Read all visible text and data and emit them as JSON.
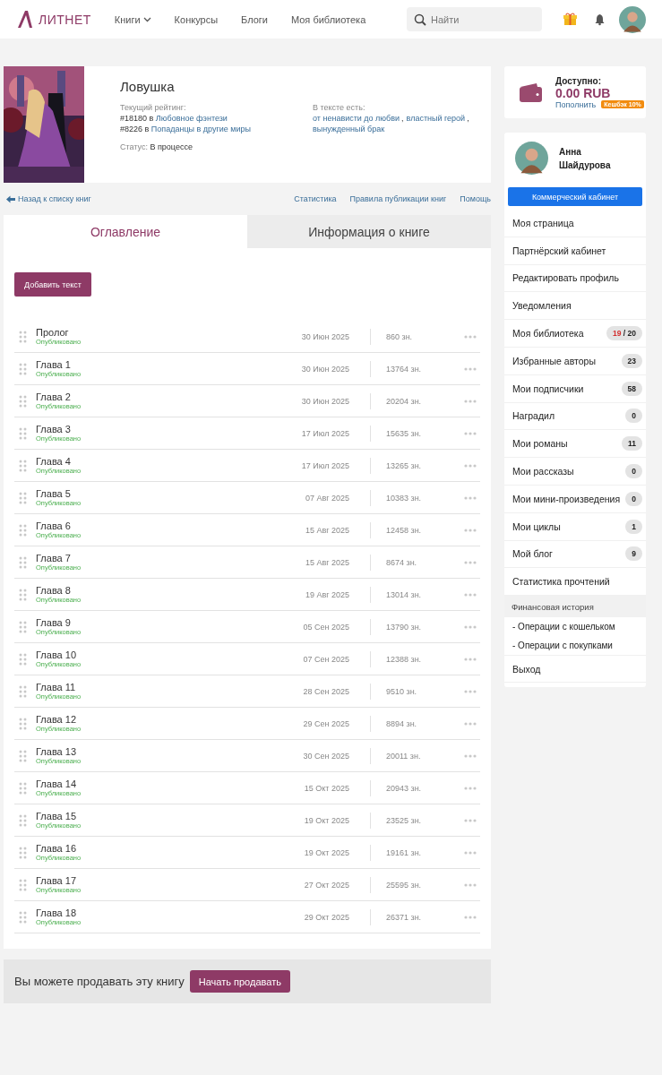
{
  "header": {
    "logo": "ЛИТНЕТ",
    "nav": [
      {
        "label": "Книги",
        "dropdown": true
      },
      {
        "label": "Конкурсы",
        "dropdown": false
      },
      {
        "label": "Блоги",
        "dropdown": false
      },
      {
        "label": "Моя библиотека",
        "dropdown": false
      }
    ],
    "search": {
      "placeholder": "Найти"
    }
  },
  "book": {
    "cover": {
      "kind": "picture"
    },
    "title": "Ловушка",
    "rating_label": "Текущий рейтинг:",
    "ratings": [
      {
        "rank": "#18180 в",
        "genre": "Любовное фэнтези"
      },
      {
        "rank": "#8226 в",
        "genre": "Попаданцы в другие миры"
      }
    ],
    "status_label": "Статус:",
    "status": "В процессе",
    "tags_label": "В тексте есть:",
    "tag_separator": ",",
    "tags": [
      "от ненависти до любви",
      "властный герой",
      "вынужденный брак"
    ]
  },
  "links": {
    "back": "Назад к списку книг",
    "right": [
      "Статистика",
      "Правила публикации книг",
      "Помощь"
    ]
  },
  "tabs": [
    {
      "label": "Оглавление",
      "selected": true
    },
    {
      "label": "Информация о книге",
      "selected": false
    }
  ],
  "add_button": "Добавить текст",
  "chapters": [
    {
      "title": "Пролог",
      "status": "Опубликовано",
      "date": "30 Июн 2025",
      "length": "860 зн."
    },
    {
      "title": "Глава 1",
      "status": "Опубликовано",
      "date": "30 Июн 2025",
      "length": "13764 зн."
    },
    {
      "title": "Глава 2",
      "status": "Опубликовано",
      "date": "30 Июн 2025",
      "length": "20204 зн."
    },
    {
      "title": "Глава 3",
      "status": "Опубликовано",
      "date": "17 Июл 2025",
      "length": "15635 зн."
    },
    {
      "title": "Глава 4",
      "status": "Опубликовано",
      "date": "17 Июл 2025",
      "length": "13265 зн."
    },
    {
      "title": "Глава 5",
      "status": "Опубликовано",
      "date": "07 Авг 2025",
      "length": "10383 зн."
    },
    {
      "title": "Глава 6",
      "status": "Опубликовано",
      "date": "15 Авг 2025",
      "length": "12458 зн."
    },
    {
      "title": "Глава 7",
      "status": "Опубликовано",
      "date": "15 Авг 2025",
      "length": "8674 зн."
    },
    {
      "title": "Глава 8",
      "status": "Опубликовано",
      "date": "19 Авг 2025",
      "length": "13014 зн."
    },
    {
      "title": "Глава 9",
      "status": "Опубликовано",
      "date": "05 Сен 2025",
      "length": "13790 зн."
    },
    {
      "title": "Глава 10",
      "status": "Опубликовано",
      "date": "07 Сен 2025",
      "length": "12388 зн."
    },
    {
      "title": "Глава 11",
      "status": "Опубликовано",
      "date": "28 Сен 2025",
      "length": "9510 зн."
    },
    {
      "title": "Глава 12",
      "status": "Опубликовано",
      "date": "29 Сен 2025",
      "length": "8894 зн."
    },
    {
      "title": "Глава 13",
      "status": "Опубликовано",
      "date": "30 Сен 2025",
      "length": "20011 зн."
    },
    {
      "title": "Глава 14",
      "status": "Опубликовано",
      "date": "15 Окт 2025",
      "length": "20943 зн."
    },
    {
      "title": "Глава 15",
      "status": "Опубликовано",
      "date": "19 Окт 2025",
      "length": "23525 зн."
    },
    {
      "title": "Глава 16",
      "status": "Опубликовано",
      "date": "19 Окт 2025",
      "length": "19161 зн."
    },
    {
      "title": "Глава 17",
      "status": "Опубликовано",
      "date": "27 Окт 2025",
      "length": "25595 зн."
    },
    {
      "title": "Глава 18",
      "status": "Опубликовано",
      "date": "29 Окт 2025",
      "length": "26371 зн."
    }
  ],
  "sell": {
    "text": "Вы можете продавать эту книгу",
    "button": "Начать продавать"
  },
  "wallet": {
    "label": "Доступно:",
    "amount": "0.00 RUB",
    "topup": "Пополнить",
    "cashback": "Кешбэк 10%"
  },
  "profile": {
    "name": "Анна Шайдурова",
    "cabinet_button": "Коммерческий кабинет"
  },
  "menu": [
    {
      "kind": "item",
      "label": "Моя страница"
    },
    {
      "kind": "item",
      "label": "Партнёрский кабинет"
    },
    {
      "kind": "item",
      "label": "Редактировать профиль"
    },
    {
      "kind": "item",
      "label": "Уведомления"
    },
    {
      "kind": "item",
      "label": "Моя библиотека",
      "count": "19",
      "limit": "/ 20"
    },
    {
      "kind": "item",
      "label": "Избранные авторы",
      "count": "23"
    },
    {
      "kind": "item",
      "label": "Мои подписчики",
      "count": "58"
    },
    {
      "kind": "item",
      "label": "Наградил",
      "count": "0"
    },
    {
      "kind": "item",
      "label": "Мои романы",
      "count": "11"
    },
    {
      "kind": "item",
      "label": "Мои рассказы",
      "count": "0"
    },
    {
      "kind": "item",
      "label": "Мои мини-произведения",
      "count": "0"
    },
    {
      "kind": "item",
      "label": "Мои циклы",
      "count": "1"
    },
    {
      "kind": "item",
      "label": "Мой блог",
      "count": "9"
    },
    {
      "kind": "item",
      "label": "Статистика прочтений"
    },
    {
      "kind": "section",
      "label": "Финансовая история"
    },
    {
      "kind": "subitem",
      "label": "- Операции с кошельком"
    },
    {
      "kind": "subitem",
      "label": "- Операции с покупками"
    },
    {
      "kind": "item",
      "label": "Выход"
    }
  ]
}
